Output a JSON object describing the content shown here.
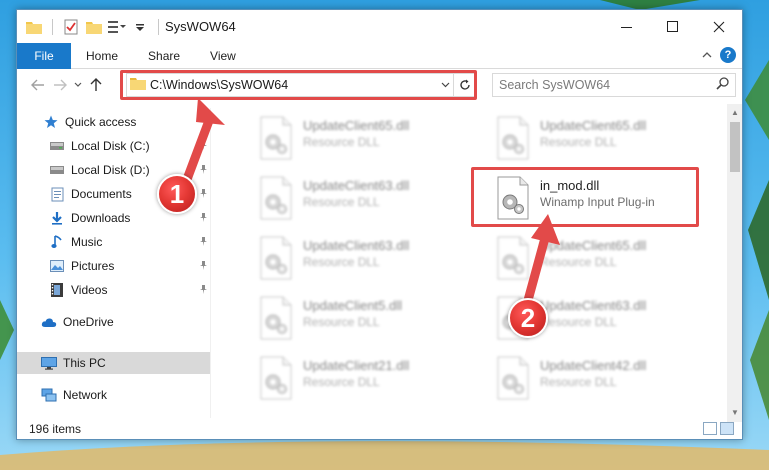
{
  "window": {
    "title": "SysWOW64"
  },
  "ribbon": {
    "tabs": [
      {
        "label": "File"
      },
      {
        "label": "Home"
      },
      {
        "label": "Share"
      },
      {
        "label": "View"
      }
    ],
    "file_color": "#1979ca"
  },
  "address": {
    "path": "C:\\Windows\\SysWOW64",
    "search_placeholder": "Search SysWOW64"
  },
  "nav": {
    "quick_access": "Quick access",
    "items": [
      {
        "label": "Local Disk (C:)",
        "icon": "drive-icon",
        "pinned": true
      },
      {
        "label": "Local Disk (D:)",
        "icon": "drive-icon",
        "pinned": true
      },
      {
        "label": "Documents",
        "icon": "documents-icon",
        "pinned": true
      },
      {
        "label": "Downloads",
        "icon": "downloads-icon",
        "pinned": true
      },
      {
        "label": "Music",
        "icon": "music-icon",
        "pinned": true
      },
      {
        "label": "Pictures",
        "icon": "pictures-icon",
        "pinned": true
      },
      {
        "label": "Videos",
        "icon": "videos-icon",
        "pinned": true
      }
    ],
    "onedrive": "OneDrive",
    "this_pc": "This PC",
    "network": "Network"
  },
  "files": [
    {
      "name": "UpdateClient65.dll",
      "desc": "Resource DLL",
      "col": 0,
      "row": 0,
      "blurred": true
    },
    {
      "name": "UpdateClient65.dll",
      "desc": "Resource DLL",
      "col": 1,
      "row": 0,
      "blurred": true
    },
    {
      "name": "UpdateClient63.dll",
      "desc": "Resource DLL",
      "col": 0,
      "row": 1,
      "blurred": true
    },
    {
      "name": "in_mod.dll",
      "desc": "Winamp Input Plug-in",
      "col": 1,
      "row": 1,
      "blurred": false
    },
    {
      "name": "UpdateClient63.dll",
      "desc": "Resource DLL",
      "col": 0,
      "row": 2,
      "blurred": true
    },
    {
      "name": "UpdateClient65.dll",
      "desc": "Resource DLL",
      "col": 1,
      "row": 2,
      "blurred": true
    },
    {
      "name": "UpdateClient5.dll",
      "desc": "Resource DLL",
      "col": 0,
      "row": 3,
      "blurred": true
    },
    {
      "name": "UpdateClient63.dll",
      "desc": "Resource DLL",
      "col": 1,
      "row": 3,
      "blurred": true
    },
    {
      "name": "UpdateClient21.dll",
      "desc": "Resource DLL",
      "col": 0,
      "row": 4,
      "blurred": true
    },
    {
      "name": "UpdateClient42.dll",
      "desc": "Resource DLL",
      "col": 1,
      "row": 4,
      "blurred": true
    }
  ],
  "status": {
    "item_count": "196 items"
  },
  "annotations": {
    "badge_1": "1",
    "badge_2": "2",
    "color": "#e24a49"
  }
}
